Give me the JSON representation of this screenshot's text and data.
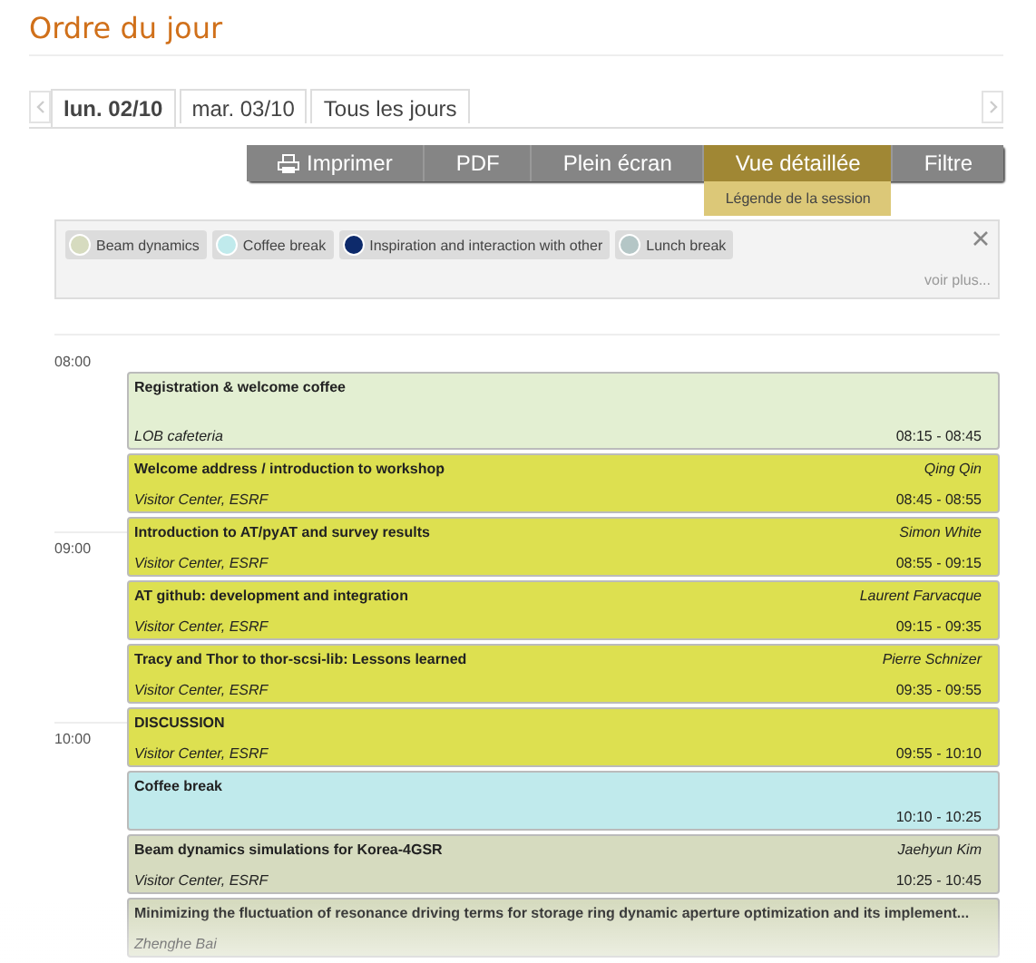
{
  "page_title": "Ordre du jour",
  "day_tabs": [
    {
      "label": "lun. 02/10",
      "selected": true
    },
    {
      "label": "mar. 03/10",
      "selected": false
    },
    {
      "label": "Tous les jours",
      "selected": false
    }
  ],
  "toolbar": [
    {
      "label": "Imprimer",
      "kind": "print",
      "selected": false
    },
    {
      "label": "PDF",
      "kind": "plain",
      "selected": false
    },
    {
      "label": "Plein écran",
      "kind": "plain",
      "selected": false
    },
    {
      "label": "Vue détaillée",
      "kind": "plain",
      "selected": true
    },
    {
      "label": "Filtre",
      "kind": "plain",
      "selected": false
    }
  ],
  "dropdown": {
    "items": [
      "Légende de la session"
    ]
  },
  "legend": {
    "items": [
      {
        "label": "Beam dynamics",
        "color": "#d6dbbf"
      },
      {
        "label": "Coffee break",
        "color": "#c0eaec"
      },
      {
        "label": "Inspiration and interaction with other",
        "color": "#0d2a6b"
      },
      {
        "label": "Lunch break",
        "color": "#b4c6c6"
      }
    ],
    "more": "voir plus..."
  },
  "timeline": [
    {
      "kind": "hour",
      "label": "08:00"
    },
    {
      "kind": "event",
      "title": "Registration & welcome coffee",
      "location": "LOB cafeteria",
      "time": "08:15 - 08:45",
      "color": "#e3efd2",
      "tall": true
    },
    {
      "kind": "event",
      "title": "Welcome address / introduction to workshop",
      "presenter": "Qing Qin",
      "location": "Visitor Center, ESRF",
      "time": "08:45 - 08:55",
      "color": "#dde050"
    },
    {
      "kind": "event",
      "hour": "09:00",
      "title": "Introduction to AT/pyAT and survey results",
      "presenter": "Simon White",
      "location": "Visitor Center, ESRF",
      "time": "08:55 - 09:15",
      "color": "#dde050"
    },
    {
      "kind": "event",
      "title": "AT github: development and integration",
      "presenter": "Laurent Farvacque",
      "location": "Visitor Center, ESRF",
      "time": "09:15 - 09:35",
      "color": "#dde050"
    },
    {
      "kind": "event",
      "title": "Tracy and Thor to thor-scsi-lib: Lessons learned",
      "presenter": "Pierre Schnizer",
      "location": "Visitor Center, ESRF",
      "time": "09:35 - 09:55",
      "color": "#dde050"
    },
    {
      "kind": "event",
      "hour": "10:00",
      "title": "DISCUSSION",
      "location": "Visitor Center, ESRF",
      "time": "09:55 - 10:10",
      "color": "#dde050"
    },
    {
      "kind": "event",
      "title": "Coffee break",
      "time": "10:10 - 10:25",
      "color": "#c0eaec"
    },
    {
      "kind": "event",
      "title": "Beam dynamics simulations for Korea-4GSR",
      "presenter": "Jaehyun Kim",
      "location": "Visitor Center, ESRF",
      "time": "10:25 - 10:45",
      "color": "#d6dbbf"
    },
    {
      "kind": "event",
      "title": "Minimizing the fluctuation of resonance driving terms for storage ring dynamic aperture optimization and its implement...",
      "presenter_below": "Zhenghe Bai",
      "color": "#d6dbbf"
    }
  ]
}
